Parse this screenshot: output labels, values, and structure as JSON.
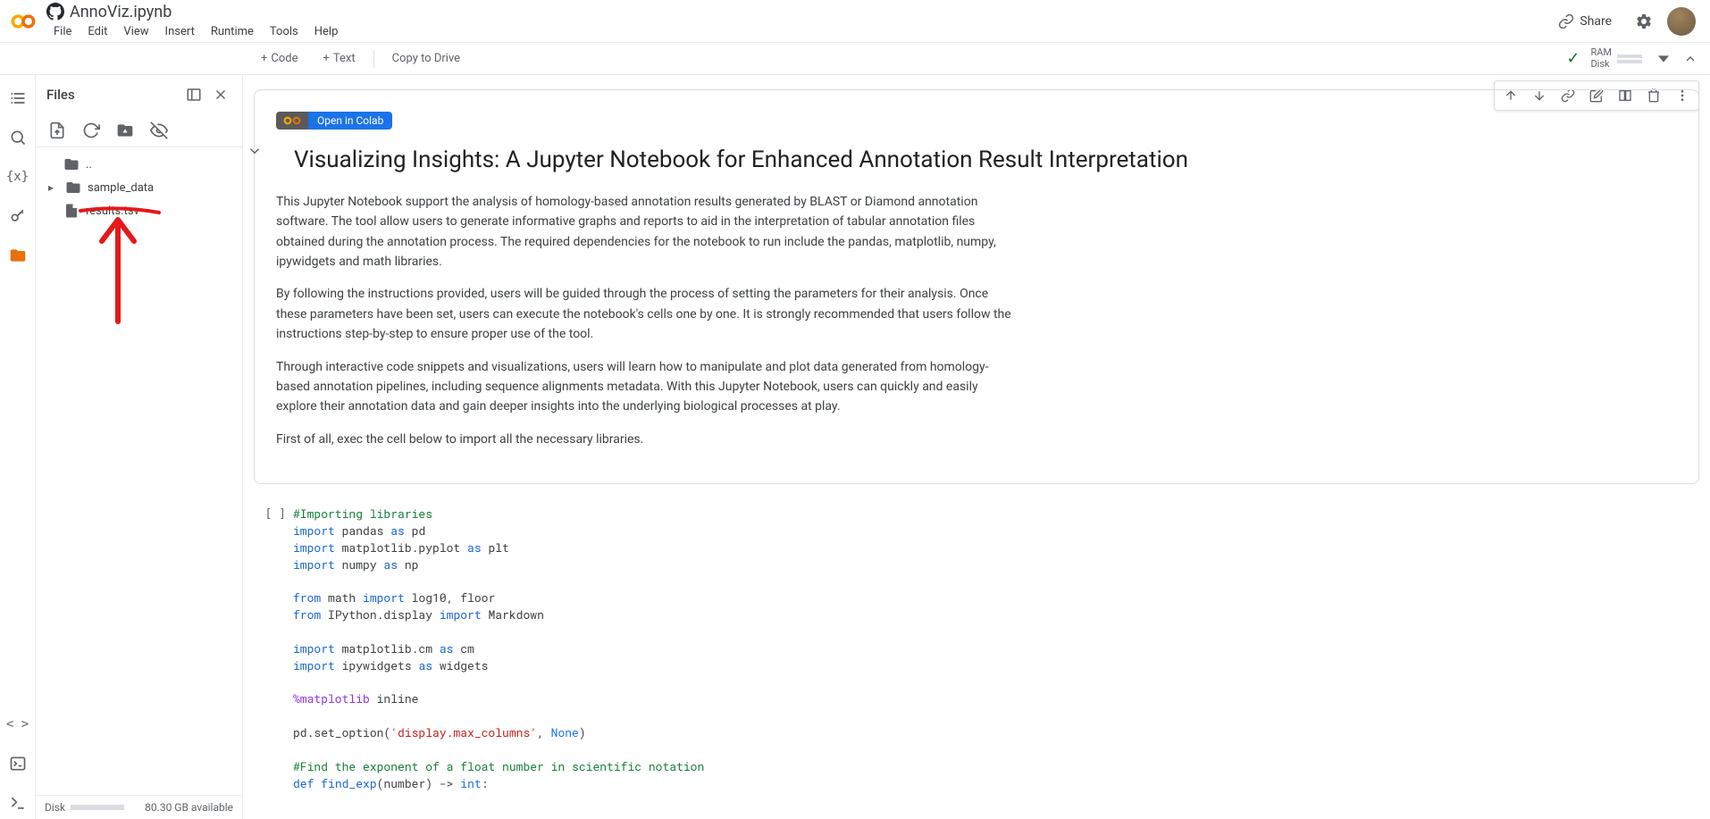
{
  "header": {
    "notebook_name": "AnnoViz.ipynb",
    "menu": [
      "File",
      "Edit",
      "View",
      "Insert",
      "Runtime",
      "Tools",
      "Help"
    ],
    "share": "Share"
  },
  "toolbar": {
    "code": "Code",
    "text": "Text",
    "copy_drive": "Copy to Drive",
    "ram": "RAM",
    "disk": "Disk"
  },
  "files_panel": {
    "title": "Files",
    "tree": {
      "parent": "..",
      "sample": "sample_data",
      "results": "results.tsv"
    },
    "disk_label": "Disk",
    "disk_avail": "80.30 GB available"
  },
  "markdown": {
    "badge": "Open in Colab",
    "title": "Visualizing Insights: A Jupyter Notebook for Enhanced Annotation Result Interpretation",
    "p1": "This Jupyter Notebook support the analysis of homology-based annotation results generated by BLAST or Diamond annotation software. The tool allow users to generate informative graphs and reports to aid in the interpretation of tabular annotation files obtained during the annotation process. The required dependencies for the notebook to run include the pandas, matplotlib, numpy, ipywidgets and math libraries.",
    "p2": "By following the instructions provided, users will be guided through the process of setting the parameters for their analysis. Once these parameters have been set, users can execute the notebook's cells one by one. It is strongly recommended that users follow the instructions step-by-step to ensure proper use of the tool.",
    "p3": "Through interactive code snippets and visualizations, users will learn how to manipulate and plot data generated from homology-based annotation pipelines, including sequence alignments metadata. With this Jupyter Notebook, users can quickly and easily explore their annotation data and gain deeper insights into the underlying biological processes at play.",
    "p4": "First of all, exec the cell below to import all the necessary libraries."
  },
  "code": {
    "l1": "#Importing libraries",
    "l2a": "import",
    "l2b": " pandas ",
    "l2c": "as",
    "l2d": " pd",
    "l3a": "import",
    "l3b": " matplotlib.pyplot ",
    "l3c": "as",
    "l3d": " plt",
    "l4a": "import",
    "l4b": " numpy ",
    "l4c": "as",
    "l4d": " np",
    "l6a": "from",
    "l6b": " math ",
    "l6c": "import",
    "l6d": " log10, floor",
    "l7a": "from",
    "l7b": " IPython.display ",
    "l7c": "import",
    "l7d": " Markdown",
    "l9a": "import",
    "l9b": " matplotlib.cm ",
    "l9c": "as",
    "l9d": " cm",
    "l10a": "import",
    "l10b": " ipywidgets ",
    "l10c": "as",
    "l10d": " widgets",
    "l12a": "%matplotlib",
    "l12b": " inline",
    "l14a": "pd.set_option(",
    "l14b": "'display.max_columns'",
    "l14c": ", ",
    "l14d": "None",
    "l14e": ")",
    "l16": "#Find the exponent of a float number in scientific notation",
    "l17a": "def",
    "l17b": "find_exp",
    "l17c": "(number) -> ",
    "l17d": "int",
    "l17e": ":"
  }
}
